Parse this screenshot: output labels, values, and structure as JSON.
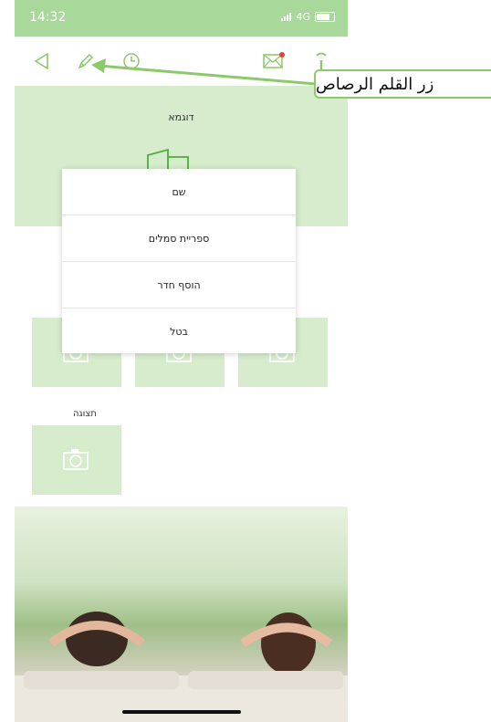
{
  "status_bar": {
    "time": "14:32",
    "network": "4G"
  },
  "toolbar": {
    "back_icon": "triangle-back-icon",
    "edit_icon": "pencil-icon",
    "timer_icon": "clock-icon",
    "mail_icon": "mail-icon",
    "signal_icon": "broadcast-icon"
  },
  "header": {
    "title": "דוגמא"
  },
  "menu": {
    "items": [
      {
        "label": "שם"
      },
      {
        "label": "ספריית סמלים"
      },
      {
        "label": "הוסף חדר"
      },
      {
        "label": "בטל"
      }
    ]
  },
  "preview": {
    "label": "תצוגה"
  },
  "callout": {
    "text": "زر القلم الرصاص"
  },
  "colors": {
    "accent": "#8cc96a",
    "tile_bg": "#d6eccc",
    "status_bg": "#a9d99a",
    "notification": "#e0443c"
  }
}
